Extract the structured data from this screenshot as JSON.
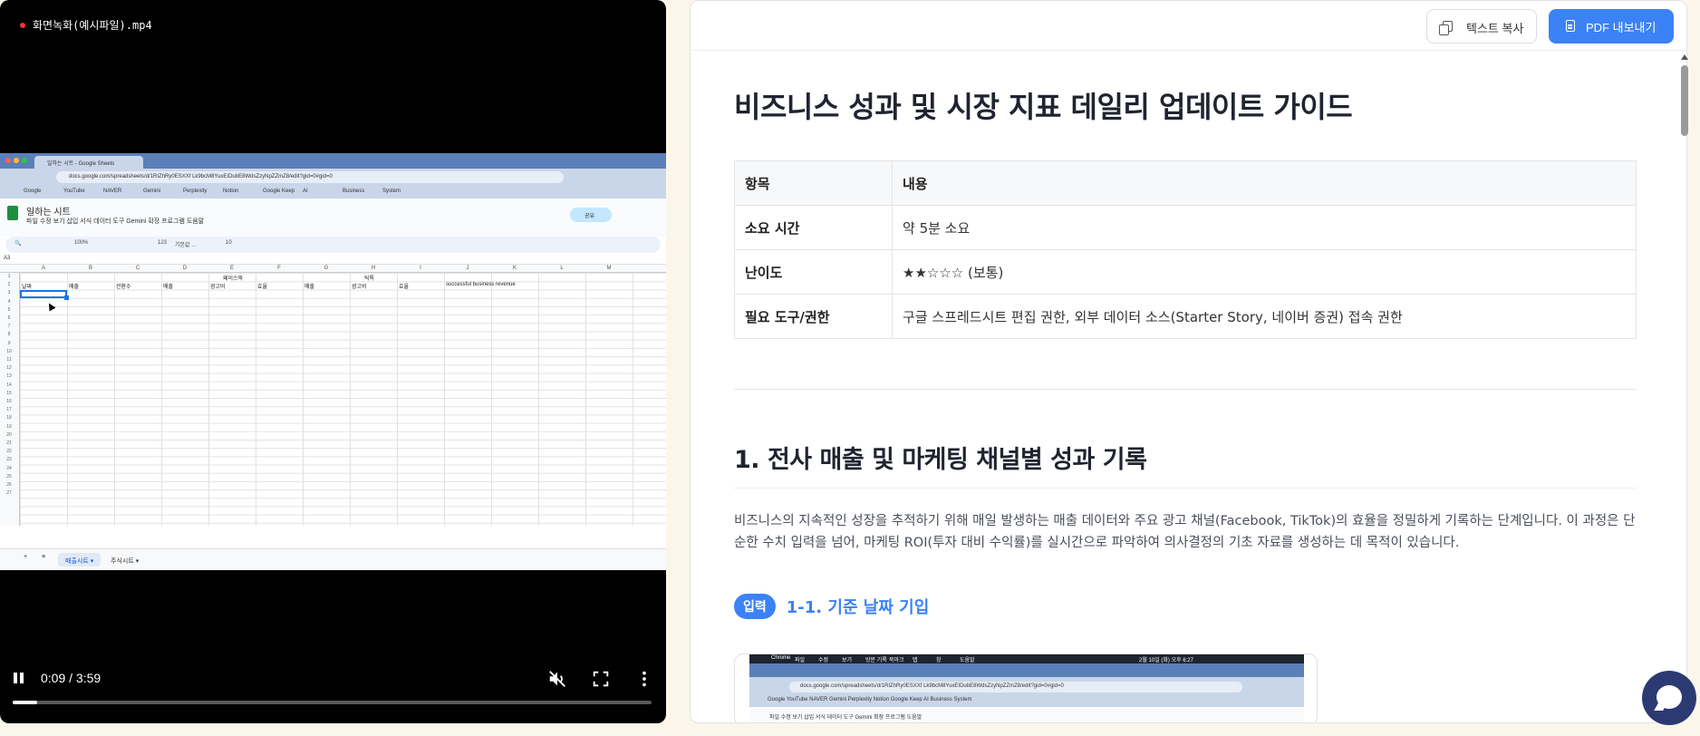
{
  "video": {
    "filename": "화면녹화(예시파일).mp4",
    "time": "0:09 / 3:59",
    "progress_fraction": 0.038,
    "controls": {
      "play": "pause-icon",
      "mute": "muted-speaker-icon",
      "fullscreen": "fullscreen-icon",
      "more": "more-vertical-icon"
    },
    "recorded_screen": {
      "browser_tab": "일하는 시트 - Google Sheets",
      "url": "docs.google.com/spreadsheets/d/1RIZhRy0ESXXf Lk9bcM8YuxEIDubE8WdsZzyNpZZmZ8/edit?gid=0#gid=0",
      "bookmarks": [
        "Google",
        "YouTube",
        "NAVER",
        "Gemini",
        "Perplexity",
        "Notion",
        "Google Keep",
        "AI",
        "Business",
        "System"
      ],
      "doc_title": "일하는 시트",
      "menu": [
        "파일",
        "수정",
        "보기",
        "삽입",
        "서식",
        "데이터",
        "도구",
        "Gemini",
        "확장 프로그램",
        "도움말"
      ],
      "share": "공유",
      "toolbar": {
        "zoom": "100%",
        "font": "기본값 ...",
        "font_size": "10",
        "format": "123"
      },
      "cell_ref": "A3",
      "columns": [
        "A",
        "B",
        "C",
        "D",
        "E",
        "F",
        "G",
        "H",
        "I",
        "J",
        "K",
        "L",
        "M"
      ],
      "group_headers": [
        {
          "text": "페이스북",
          "col": 4
        },
        {
          "text": "틱톡",
          "col": 7
        }
      ],
      "row2": [
        {
          "text": "날짜",
          "col": 0
        },
        {
          "text": "매출",
          "col": 1
        },
        {
          "text": "전환수",
          "col": 2
        },
        {
          "text": "매출",
          "col": 3
        },
        {
          "text": "광고비",
          "col": 4
        },
        {
          "text": "효율",
          "col": 5
        },
        {
          "text": "매출",
          "col": 6
        },
        {
          "text": "광고비",
          "col": 7
        },
        {
          "text": "효율",
          "col": 8
        },
        {
          "text": "successful business revenue",
          "col": 9
        }
      ],
      "row_count": 27,
      "sheets": [
        "매출시트",
        "주식시트"
      ]
    }
  },
  "toolbar": {
    "copy_label": "텍스트 복사",
    "pdf_label": "PDF 내보내기"
  },
  "doc": {
    "title": "비즈니스 성과 및 시장 지표 데일리 업데이트 가이드",
    "table": {
      "headers": [
        "항목",
        "내용"
      ],
      "rows": [
        {
          "k": "소요 시간",
          "v": "약 5분 소요"
        },
        {
          "k": "난이도",
          "v": "★★☆☆☆ (보통)"
        },
        {
          "k": "필요 도구/권한",
          "v": "구글 스프레드시트 편집 권한, 외부 데이터 소스(Starter Story, 네이버 증권) 접속 권한"
        }
      ]
    },
    "section1": {
      "title": "1. 전사 매출 및 마케팅 채널별 성과 기록",
      "desc": "비즈니스의 지속적인 성장을 추적하기 위해 매일 발생하는 매출 데이터와 주요 광고 채널(Facebook, TikTok)의 효율을 정밀하게 기록하는 단계입니다. 이 과정은 단순한 수치 입력을 넘어, 마케팅 ROI(투자 대비 수익률)를 실시간으로 파악하여 의사결정의 기초 자료를 생성하는 데 목적이 있습니다.",
      "step_badge": "입력",
      "step_title": "1-1. 기준 날짜 기입"
    },
    "screenshot": {
      "mac_menu": [
        "Chrome",
        "파일",
        "수정",
        "보기",
        "방문 기록",
        "북마크",
        "탭",
        "창",
        "도움말"
      ],
      "clock": "2월 10일 (화) 오후 6:27",
      "url": "docs.google.com/spreadsheets/d/1RIZhRy0ESXXf Lk9bcM8YuxEIDubE8WdsZzyNpZZmZ8/edit?gid=0#gid=0",
      "bookmarks": "Google  YouTube  NAVER  Gemini  Perplexity  Notion  Google Keep  AI  Business  System",
      "menu": "파일  수정  보기  삽입  서식  데이터  도구  Gemini  확장 프로그램  도움말"
    }
  }
}
